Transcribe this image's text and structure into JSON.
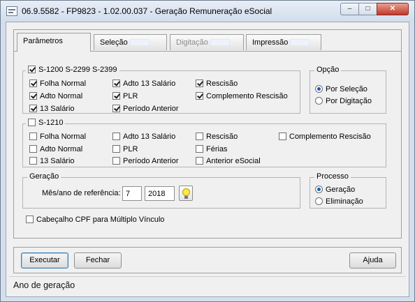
{
  "window": {
    "title": "06.9.5582 - FP9823 - 1.02.00.037 - Geração Remuneração eSocial",
    "minimize_glyph": "–",
    "maximize_glyph": "□",
    "close_glyph": "✕"
  },
  "tabs": [
    {
      "label": "Parâmetros",
      "state": "active"
    },
    {
      "label": "Seleção",
      "state": "enabled"
    },
    {
      "label": "Digitação",
      "state": "disabled"
    },
    {
      "label": "Impressão",
      "state": "enabled"
    }
  ],
  "group_s1200": {
    "title": "S-1200 S-2299 S-2399",
    "checked": true,
    "items": [
      {
        "label": "Folha Normal",
        "checked": true
      },
      {
        "label": "Adto 13 Salário",
        "checked": true
      },
      {
        "label": "Rescisão",
        "checked": true
      },
      {
        "label": "Adto Normal",
        "checked": true
      },
      {
        "label": "PLR",
        "checked": true
      },
      {
        "label": "Complemento Rescisão",
        "checked": true
      },
      {
        "label": "13 Salário",
        "checked": true
      },
      {
        "label": "Período Anterior",
        "checked": true
      }
    ]
  },
  "group_opcao": {
    "title": "Opção",
    "options": [
      {
        "label": "Por Seleção",
        "selected": true
      },
      {
        "label": "Por Digitação",
        "selected": false
      }
    ]
  },
  "group_s1210": {
    "title": "S-1210",
    "checked": false,
    "items": [
      {
        "label": "Folha Normal",
        "checked": false
      },
      {
        "label": "Adto 13 Salário",
        "checked": false
      },
      {
        "label": "Rescisão",
        "checked": false
      },
      {
        "label": "Complemento Rescisão",
        "checked": false
      },
      {
        "label": "Adto Normal",
        "checked": false
      },
      {
        "label": "PLR",
        "checked": false
      },
      {
        "label": "Férias",
        "checked": false
      },
      {
        "label": "13 Salário",
        "checked": false
      },
      {
        "label": "Período Anterior",
        "checked": false
      },
      {
        "label": "Anterior eSocial",
        "checked": false
      }
    ]
  },
  "group_geracao": {
    "title": "Geração",
    "ref_label": "Mês/ano de referência:",
    "month": "7",
    "year": "2018"
  },
  "group_processo": {
    "title": "Processo",
    "options": [
      {
        "label": "Geração",
        "selected": true
      },
      {
        "label": "Eliminação",
        "selected": false
      }
    ]
  },
  "cabecalho_checkbox": {
    "label": "Cabeçalho CPF para Múltiplo Vínculo",
    "checked": false
  },
  "buttons": {
    "executar": "Executar",
    "fechar": "Fechar",
    "ajuda": "Ajuda"
  },
  "status": "Ano de geração"
}
